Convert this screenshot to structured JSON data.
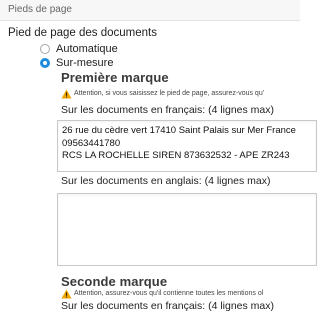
{
  "section": {
    "title": "Pieds de page"
  },
  "footer": {
    "label": "Pied de page des documents",
    "options": [
      {
        "label": "Automatique",
        "selected": false
      },
      {
        "label": "Sur-mesure",
        "selected": true
      }
    ]
  },
  "first_brand": {
    "title": "Première marque",
    "warning": "Attention, si vous saisissez le pied de page, assurez-vous qu'",
    "french_label": "Sur les documents en français: (4 lignes max)",
    "french_lines": [
      "26 rue du cèdre vert 17410 Saint Palais sur Mer France",
      "09563441780",
      "RCS LA ROCHELLE SIREN 873632532 - APE ZR243"
    ],
    "english_label": "Sur les documents en anglais: (4 lignes max)",
    "english_lines": []
  },
  "second_brand": {
    "title": "Seconde marque",
    "warning": "Attention, assurez-vous qu'il contienne toutes les mentions ol",
    "french_label": "Sur les documents en français: (4 lignes max)"
  },
  "colors": {
    "radio_selected": "#1e8bdc",
    "warning_icon": "#f0a800",
    "header_bg": "#f7f7f7"
  }
}
